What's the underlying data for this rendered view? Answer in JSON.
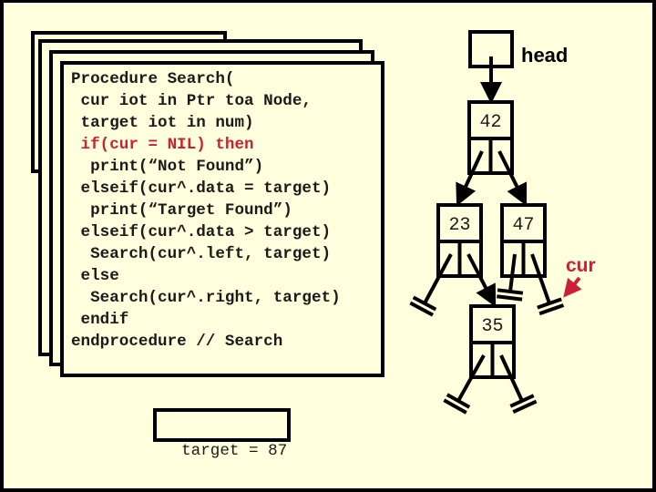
{
  "stack_frames": {
    "count": 4,
    "active_procedure": {
      "lines": [
        {
          "text": "Procedure Search(",
          "highlight": false
        },
        {
          "text": " cur iot in Ptr toa Node,",
          "highlight": false
        },
        {
          "text": " target iot in num)",
          "highlight": false
        },
        {
          "text": " if(cur = NIL) then",
          "highlight": true
        },
        {
          "text": "  print(“Not Found”)",
          "highlight": false
        },
        {
          "text": " elseif(cur^.data = target)",
          "highlight": false
        },
        {
          "text": "  print(“Target Found”)",
          "highlight": false
        },
        {
          "text": " elseif(cur^.data > target)",
          "highlight": false
        },
        {
          "text": "  Search(cur^.left, target)",
          "highlight": false
        },
        {
          "text": " else",
          "highlight": false
        },
        {
          "text": "  Search(cur^.right, target)",
          "highlight": false
        },
        {
          "text": " endif",
          "highlight": false
        },
        {
          "text": "endprocedure // Search",
          "highlight": false
        }
      ]
    }
  },
  "target_box": {
    "label": "target = 87"
  },
  "tree": {
    "head_label": "head",
    "cur_label": "cur",
    "nodes": [
      {
        "id": "n42",
        "value": "42"
      },
      {
        "id": "n23",
        "value": "23"
      },
      {
        "id": "n47",
        "value": "47"
      },
      {
        "id": "n35",
        "value": "35"
      }
    ],
    "edges": [
      {
        "from": "head",
        "to": "n42"
      },
      {
        "from": "n42",
        "side": "left",
        "to": "n23"
      },
      {
        "from": "n42",
        "side": "right",
        "to": "n47"
      },
      {
        "from": "n23",
        "side": "left",
        "to": "NIL"
      },
      {
        "from": "n23",
        "side": "right",
        "to": "n35"
      },
      {
        "from": "n47",
        "side": "left",
        "to": "NIL"
      },
      {
        "from": "n47",
        "side": "right",
        "to": "NIL"
      },
      {
        "from": "n35",
        "side": "left",
        "to": "NIL"
      },
      {
        "from": "n35",
        "side": "right",
        "to": "NIL"
      }
    ],
    "cur_points_to": "n47.right"
  },
  "colors": {
    "background": "#ffffdd",
    "highlight": "#cc1f3a",
    "ink": "#000000"
  }
}
